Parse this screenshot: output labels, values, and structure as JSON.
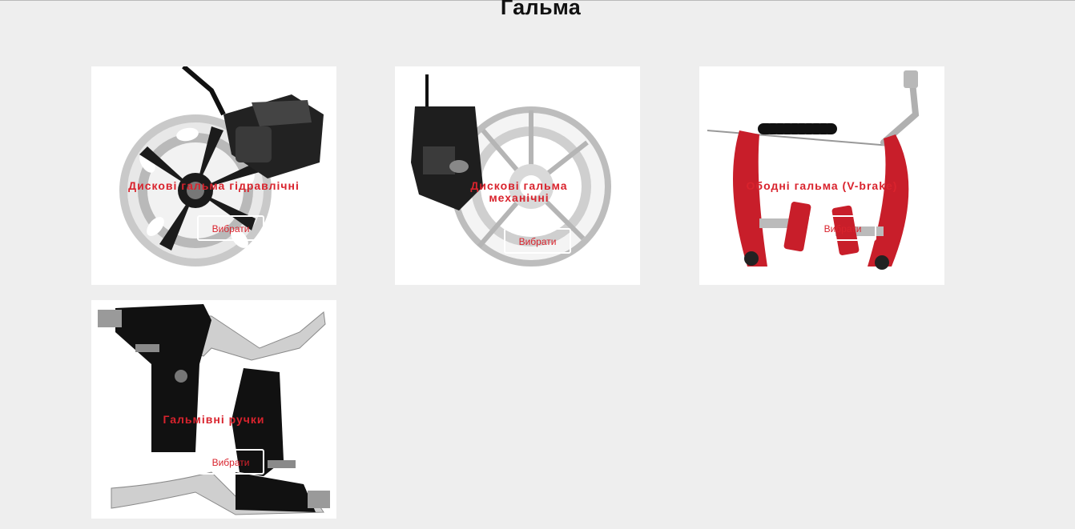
{
  "page": {
    "title": "Гальма"
  },
  "cards": [
    {
      "title": "Дискові гальма гідравлічні",
      "button": "Вибрати"
    },
    {
      "title": "Дискові гальма механічні",
      "button": "Вибрати"
    },
    {
      "title": "Ободні гальма (V-brake)",
      "button": "Вибрати"
    },
    {
      "title": "Гальмівні ручки",
      "button": "Вибрати"
    }
  ],
  "colors": {
    "accent": "#d9232d",
    "background": "#eeeeee",
    "card": "#ffffff"
  }
}
